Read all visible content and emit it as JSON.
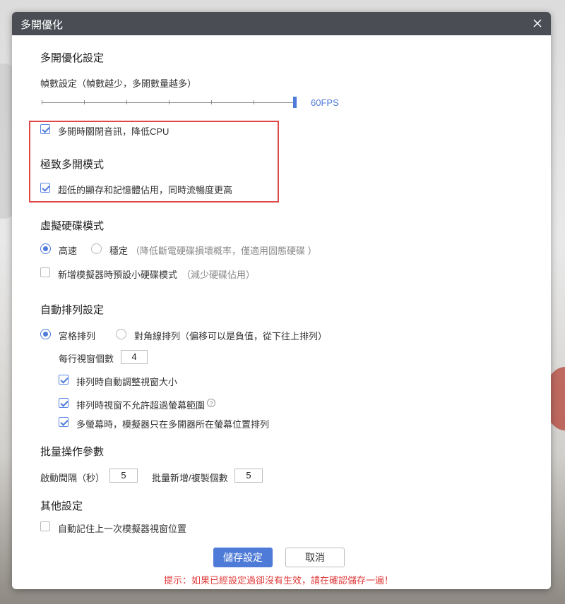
{
  "dialog": {
    "title": "多開優化"
  },
  "optimize": {
    "heading": "多開優化設定",
    "frame_label": "幀數設定（幀數越少，多開數量越多）",
    "fps_value": "60FPS",
    "fps_level": 1.0,
    "mute_label": "多開時關閉音訊，降低CPU",
    "mute_checked": true
  },
  "extreme": {
    "heading": "極致多開模式",
    "option_label": "超低的顯存和記憶體佔用，同時流暢度更高",
    "option_checked": true
  },
  "disk": {
    "heading": "虛擬硬碟模式",
    "fast_label": "高速",
    "stable_label": "穩定",
    "stable_note": "（降低斷電硬碟損壞概率，僅適用固態硬碟 ）",
    "selected": "fast",
    "small_disk_label": "新增模擬器時預設小硬碟模式",
    "small_disk_note": "（減少硬碟佔用）",
    "small_disk_checked": false
  },
  "arrange": {
    "heading": "自動排列設定",
    "grid_label": "宮格排列",
    "diagonal_label": "對角線排列",
    "diagonal_note": "（偏移可以是負值，從下往上排列）",
    "selected": "grid",
    "per_row_label": "每行視窗個數",
    "per_row_value": "4",
    "auto_resize_label": "排列時自動調整視窗大小",
    "no_overflow_label": "排列時視窗不允許超過螢幕範圍",
    "multi_screen_label": "多螢幕時，模擬器只在多開器所在螢幕位置排列",
    "help_glyph": "?"
  },
  "batch": {
    "heading": "批量操作參數",
    "interval_label": "啟動間隔（秒）",
    "interval_value": "5",
    "count_label": "批量新增/複製個數",
    "count_value": "5"
  },
  "other": {
    "heading": "其他設定",
    "remember_label": "自動記住上一次模擬器視窗位置",
    "remember_checked": false
  },
  "buttons": {
    "save": "儲存設定",
    "cancel": "取消"
  },
  "hint": "提示：如果已經設定過卻沒有生效，請在確認儲存一遍！",
  "colors": {
    "accent": "#4f7bd8",
    "highlight": "#e04848",
    "titlebar": "#4a4d54"
  },
  "icons": {
    "close": "close-icon",
    "check": "checkmark-icon",
    "help": "question-circle-icon"
  }
}
